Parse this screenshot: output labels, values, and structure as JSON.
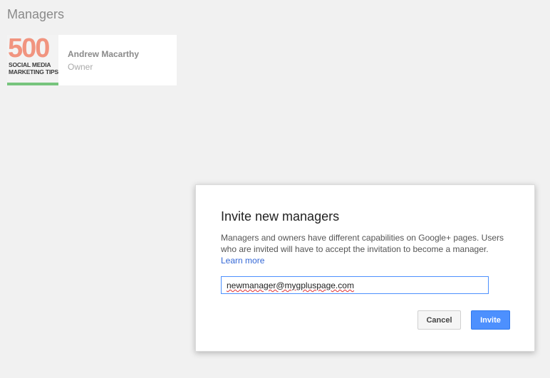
{
  "page": {
    "section_title": "Managers"
  },
  "managers": [
    {
      "avatar": {
        "number": "500",
        "line1": "SOCIAL MEDIA",
        "line2": "MARKETING TIPS"
      },
      "name": "Andrew Macarthy",
      "role": "Owner"
    }
  ],
  "dialog": {
    "title": "Invite new managers",
    "description": "Managers and owners have different capabilities on Google+ pages. Users who are invited will have to accept the invitation to become a manager.",
    "learn_more": "Learn more",
    "email_value": "newmanager@mygpluspage.com",
    "cancel_label": "Cancel",
    "invite_label": "Invite"
  },
  "colors": {
    "accent_blue": "#4d90fe",
    "link_blue": "#3367d6",
    "avatar_green_bar": "#76c47d",
    "avatar_number": "#f1947f"
  }
}
